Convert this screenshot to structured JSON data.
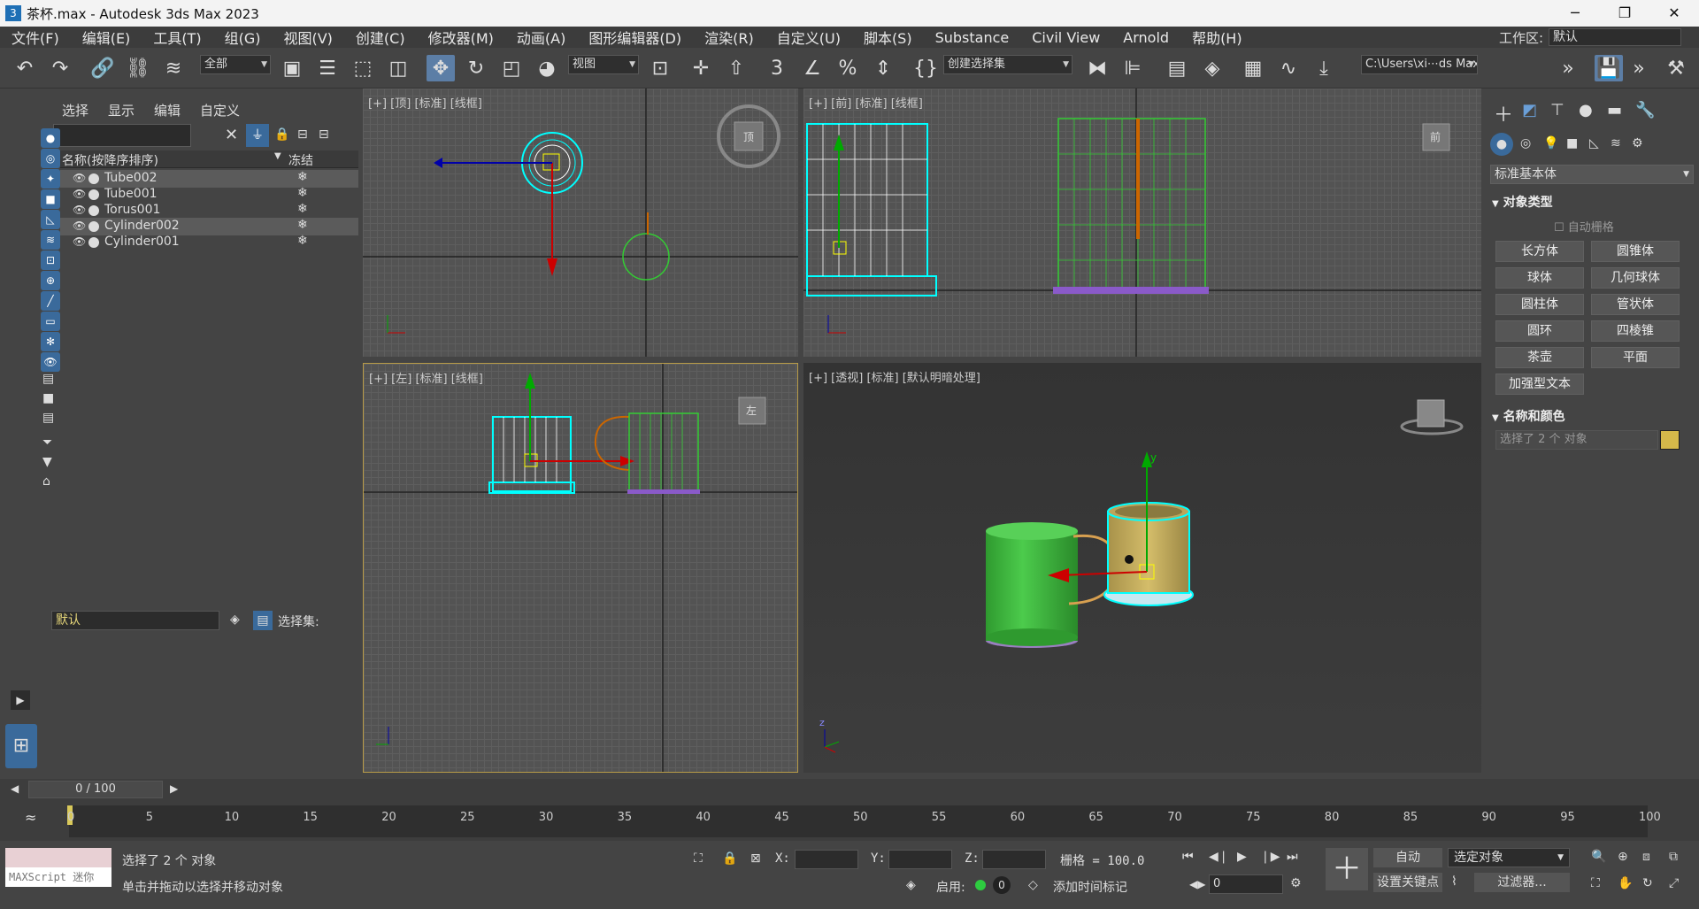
{
  "window": {
    "icon": "3",
    "title": "茶杯.max - Autodesk 3ds Max 2023",
    "controls": [
      "─",
      "❐",
      "✕"
    ]
  },
  "menu": [
    "文件(F)",
    "编辑(E)",
    "工具(T)",
    "组(G)",
    "视图(V)",
    "创建(C)",
    "修改器(M)",
    "动画(A)",
    "图形编辑器(D)",
    "渲染(R)",
    "自定义(U)",
    "脚本(S)",
    "Substance",
    "Civil View",
    "Arnold",
    "帮助(H)"
  ],
  "workspace": {
    "label": "工作区:",
    "value": "默认"
  },
  "toolbar": {
    "filter_value": "全部",
    "ref_coord_value": "视图",
    "selection_set_placeholder": "创建选择集",
    "path_value": "C:\\Users\\xi⋯ds Max 2023",
    "icons": [
      "undo-icon",
      "redo-icon",
      "link-icon",
      "unlink-icon",
      "bind-spacewarp-icon",
      "select-object-icon",
      "select-by-name-icon",
      "rect-region-icon",
      "window-crossing-icon",
      "move-icon",
      "rotate-icon",
      "scale-icon",
      "placement-icon",
      "pivot-icon",
      "select-manipulate-icon",
      "snap-3d-icon",
      "angle-snap-icon",
      "percent-snap-icon",
      "spinner-snap-icon",
      "edit-named-sel-icon",
      "mirror-icon",
      "align-icon",
      "scene-explorer-icon",
      "layer-explorer-icon",
      "ribbon-icon",
      "curve-editor-icon",
      "schematic-icon",
      "render-setup-icon",
      "render-frame-icon",
      "render-icon"
    ]
  },
  "scene_explorer": {
    "tabs": [
      "选择",
      "显示",
      "编辑",
      "自定义"
    ],
    "col_name": "名称(按降序排序)",
    "col_freeze": "冻结",
    "objects": [
      {
        "name": "Tube002",
        "selected": true
      },
      {
        "name": "Tube001",
        "selected": false
      },
      {
        "name": "Torus001",
        "selected": false
      },
      {
        "name": "Cylinder002",
        "selected": true
      },
      {
        "name": "Cylinder001",
        "selected": false
      }
    ],
    "layer_value": "默认",
    "selection_set_label": "选择集:"
  },
  "viewports": {
    "top": "[+] [顶] [标准] [线框]",
    "front": "[+] [前] [标准] [线框]",
    "left": "[+] [左] [标准] [线框]",
    "persp": "[+] [透视] [标准] [默认明暗处理]",
    "viewcube_labels": {
      "top": "顶",
      "front": "前",
      "left": "左"
    },
    "gizmo_axes": {
      "x": "x",
      "y": "y",
      "z": "z"
    }
  },
  "command_panel": {
    "category": "标准基本体",
    "object_type_header": "对象类型",
    "autogrid": "自动栅格",
    "buttons": [
      "长方体",
      "圆锥体",
      "球体",
      "几何球体",
      "圆柱体",
      "管状体",
      "圆环",
      "四棱锥",
      "茶壶",
      "平面",
      "加强型文本"
    ],
    "name_color_header": "名称和颜色",
    "name_value": "选择了 2 个 对象",
    "object_color": "#d4b84a"
  },
  "timeline": {
    "frame_display": "0 / 100",
    "ticks": [
      "0",
      "5",
      "10",
      "15",
      "20",
      "25",
      "30",
      "35",
      "40",
      "45",
      "50",
      "55",
      "60",
      "65",
      "70",
      "75",
      "80",
      "85",
      "90",
      "95",
      "100"
    ]
  },
  "status": {
    "maxscript": "MAXScript 迷你",
    "selected": "选择了 2 个 对象",
    "prompt": "单击并拖动以选择并移动对象",
    "x_label": "X:",
    "y_label": "Y:",
    "z_label": "Z:",
    "grid": "栅格 = 100.0",
    "enable_label": "启用:",
    "enable_value": "0",
    "add_time_tag": "添加时间标记",
    "auto_key": "自动",
    "set_key": "设置关键点",
    "key_filter_value": "选定对象",
    "filters": "过滤器...",
    "current_frame": "0"
  },
  "colors": {
    "accent": "#5c7ea6",
    "selection": "#00ffff",
    "green_obj": "#3fbf3f",
    "yellow_obj": "#c8b25a"
  }
}
